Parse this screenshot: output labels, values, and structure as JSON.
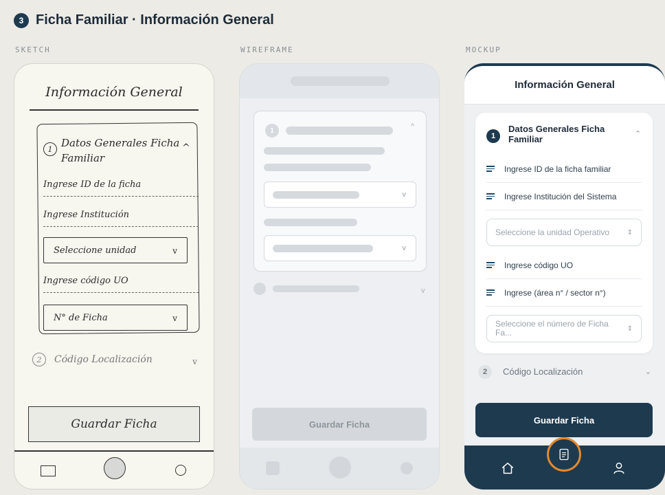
{
  "page": {
    "step_number": "3",
    "title": "Ficha Familiar · Información General"
  },
  "columns": {
    "sketch": "SKETCH",
    "wireframe": "WIREFRAME",
    "mockup": "MOCKUP"
  },
  "sketch": {
    "title": "Información General",
    "section1_number": "1",
    "section1_title": "Datos Generales Ficha Familiar",
    "section1_caret": "^",
    "field_id": "Ingrese ID de la ficha",
    "field_institucion": "Ingrese Institución",
    "select_unidad": "Seleccione unidad",
    "field_codigo": "Ingrese código UO",
    "select_ficha": "N° de Ficha",
    "select_caret": "v",
    "section2_number": "2",
    "section2_title": "Código Localización",
    "section2_caret": "v",
    "save_button": "Guardar Ficha"
  },
  "wireframe": {
    "section1_number": "1",
    "caret_up": "^",
    "caret_down": "v",
    "save_button": "Guardar Ficha"
  },
  "mockup": {
    "header_title": "Información General",
    "section1_number": "1",
    "section1_title": "Datos Generales Ficha Familiar",
    "fields": [
      "Ingrese ID de la ficha familiar",
      "Ingrese Institución del Sistema",
      "Ingrese código UO",
      "Ingrese (área n° / sector n°)"
    ],
    "select_unidad_placeholder": "Seleccione la unidad Operativo",
    "select_ficha_placeholder": "Seleccione el número de Ficha Fa...",
    "section2_number": "2",
    "section2_title": "Código Localización",
    "save_button": "Guardar Ficha",
    "nav_icons": [
      "home-icon",
      "document-icon",
      "user-icon"
    ],
    "accent_color": "#1e3a4f",
    "highlight_color": "#e08a2e"
  }
}
